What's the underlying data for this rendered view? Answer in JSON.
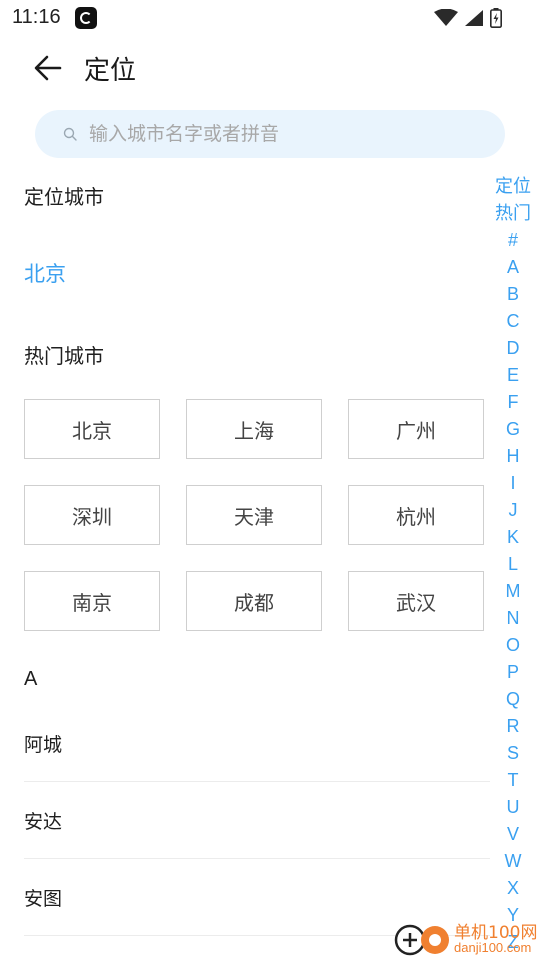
{
  "status_bar": {
    "time": "11:16"
  },
  "header": {
    "title": "定位",
    "back_label": "back"
  },
  "search": {
    "placeholder": "输入城市名字或者拼音"
  },
  "located": {
    "section_title": "定位城市",
    "city": "北京"
  },
  "hot": {
    "section_title": "热门城市",
    "cities": [
      "北京",
      "上海",
      "广州",
      "深圳",
      "天津",
      "杭州",
      "南京",
      "成都",
      "武汉"
    ]
  },
  "list": {
    "letter": "A",
    "cities": [
      "阿城",
      "安达",
      "安图"
    ]
  },
  "index": {
    "items": [
      "定位",
      "热门",
      "#",
      "A",
      "B",
      "C",
      "D",
      "E",
      "F",
      "G",
      "H",
      "I",
      "J",
      "K",
      "L",
      "M",
      "N",
      "O",
      "P",
      "Q",
      "R",
      "S",
      "T",
      "U",
      "V",
      "W",
      "X",
      "Y",
      "Z"
    ]
  },
  "watermark": {
    "title": "单机100网",
    "domain": "danji100.com"
  },
  "colors": {
    "accent": "#3aa0f0",
    "search_bg": "#e9f4fd",
    "watermark": "#f08030"
  }
}
